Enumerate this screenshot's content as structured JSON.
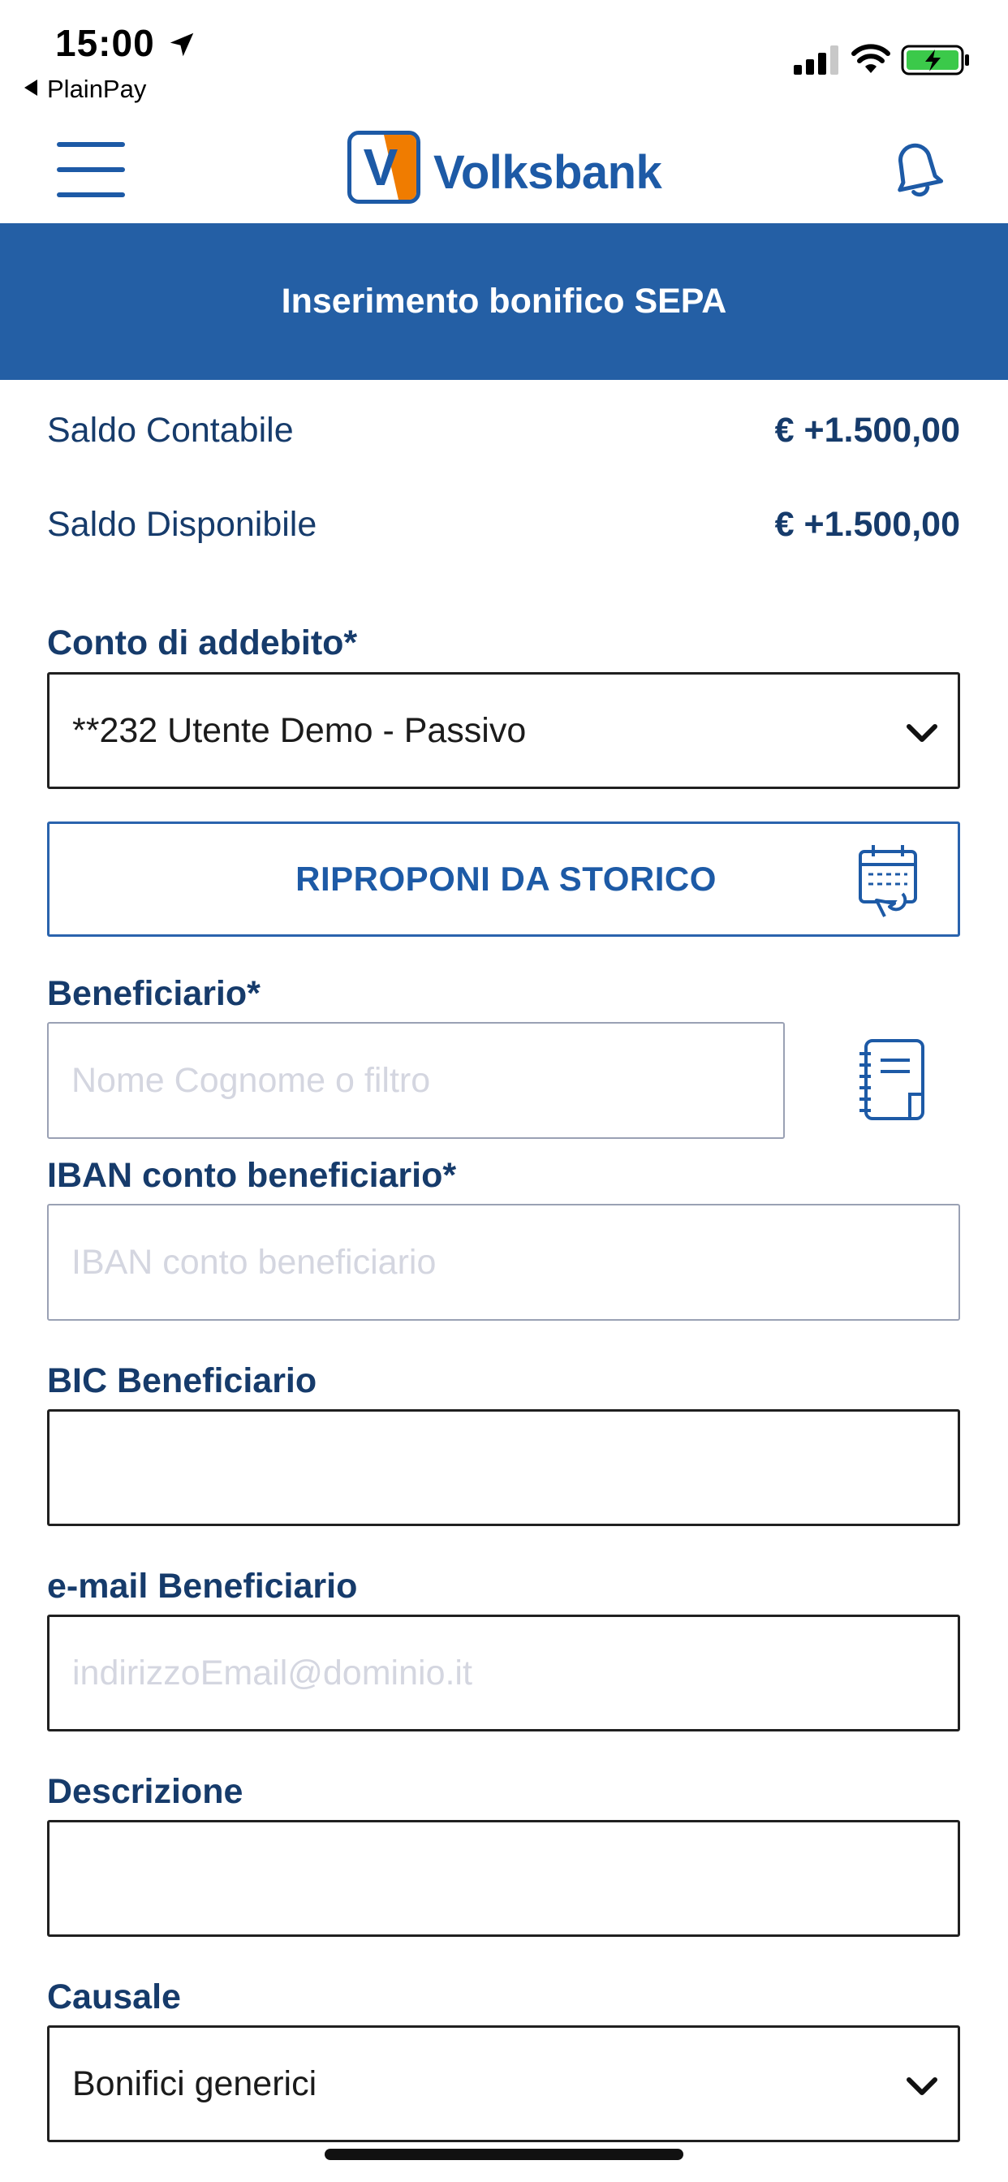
{
  "status_bar": {
    "time": "15:00",
    "back_app": "PlainPay"
  },
  "header": {
    "brand": "Volksbank",
    "logo_letter": "V"
  },
  "page": {
    "title": "Inserimento bonifico SEPA"
  },
  "balances": [
    {
      "label": "Saldo Contabile",
      "value": "€ +1.500,00"
    },
    {
      "label": "Saldo Disponibile",
      "value": "€ +1.500,00"
    }
  ],
  "form": {
    "account": {
      "label": "Conto di addebito*",
      "value": "**232 Utente Demo - Passivo"
    },
    "history_button": "RIPROPONI DA STORICO",
    "beneficiary": {
      "label": "Beneficiario*",
      "placeholder": "Nome Cognome o filtro"
    },
    "iban": {
      "label": "IBAN conto beneficiario*",
      "placeholder": "IBAN conto beneficiario"
    },
    "bic": {
      "label": "BIC Beneficiario",
      "value": ""
    },
    "email": {
      "label": "e-mail Beneficiario",
      "placeholder": "indirizzoEmail@dominio.it"
    },
    "description": {
      "label": "Descrizione",
      "value": ""
    },
    "reason": {
      "label": "Causale",
      "value": "Bonifici generici"
    }
  },
  "colors": {
    "brand_blue": "#245fa5",
    "text_navy": "#163b6b",
    "logo_orange": "#f07c00"
  }
}
